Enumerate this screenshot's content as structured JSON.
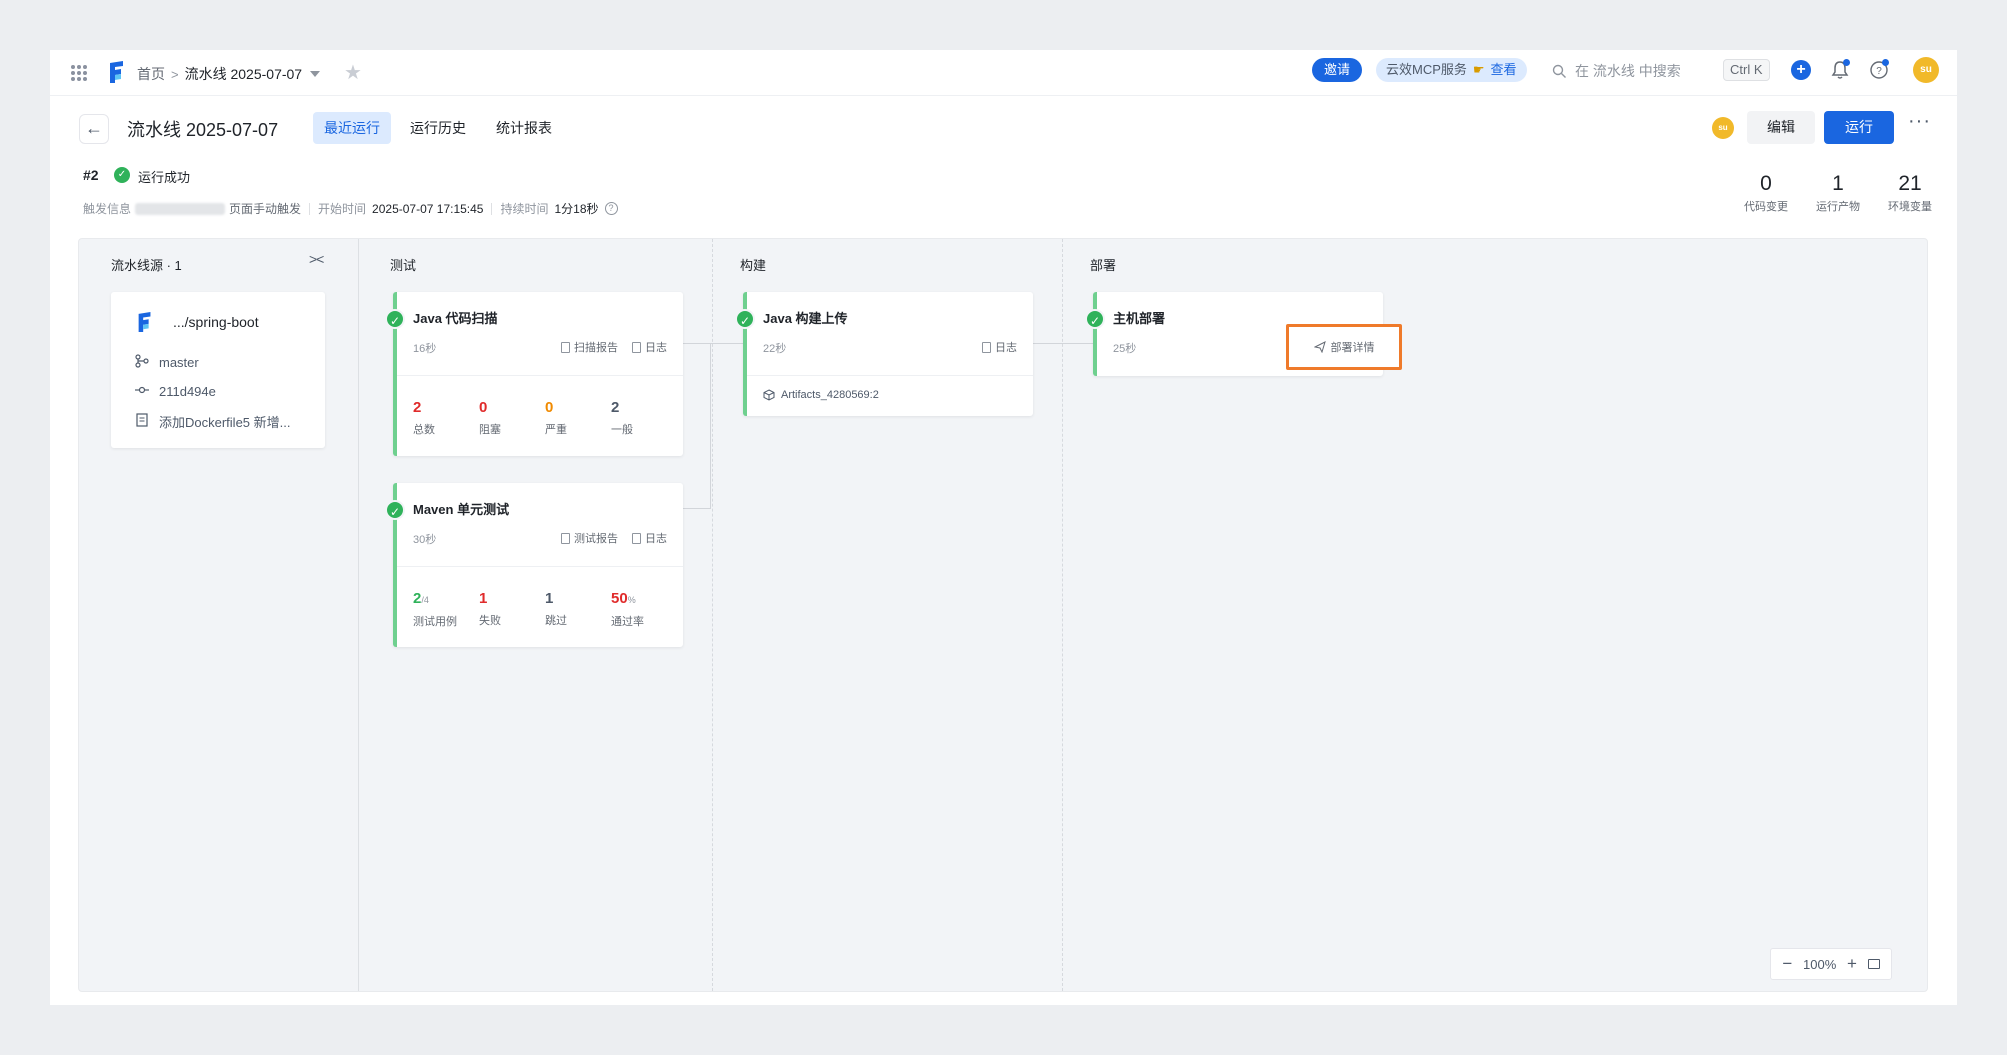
{
  "topbar": {
    "breadcrumb_home": "首页",
    "breadcrumb_current": "流水线 2025-07-07",
    "invite_label": "邀请",
    "mcp_label": "云效MCP服务",
    "mcp_view": "查看",
    "search_placeholder": "在 流水线 中搜索",
    "shortcut": "Ctrl K",
    "avatar": "su"
  },
  "header": {
    "title": "流水线 2025-07-07",
    "tabs": [
      "最近运行",
      "运行历史",
      "统计报表"
    ],
    "active_tab": "最近运行",
    "avatar": "su",
    "edit_label": "编辑",
    "run_label": "运行",
    "more": "···"
  },
  "run": {
    "number": "#2",
    "status": "运行成功",
    "trigger_label": "触发信息",
    "trigger_value": "页面手动触发",
    "start_label": "开始时间",
    "start_value": "2025-07-07 17:15:45",
    "duration_label": "持续时间",
    "duration_value": "1分18秒"
  },
  "stats": [
    {
      "value": "0",
      "label": "代码变更"
    },
    {
      "value": "1",
      "label": "运行产物"
    },
    {
      "value": "21",
      "label": "环境变量"
    }
  ],
  "source": {
    "title": "流水线源 · 1",
    "repo": ".../spring-boot",
    "branch": "master",
    "commit": "211d494e",
    "message": "添加Dockerfile5 新增..."
  },
  "stages": {
    "test": "测试",
    "build": "构建",
    "deploy": "部署"
  },
  "jobs": {
    "scan": {
      "name": "Java 代码扫描",
      "duration": "16秒",
      "report": "扫描报告",
      "log": "日志",
      "metrics": [
        {
          "value": "2",
          "label": "总数"
        },
        {
          "value": "0",
          "label": "阻塞"
        },
        {
          "value": "0",
          "label": "严重"
        },
        {
          "value": "2",
          "label": "一般"
        }
      ]
    },
    "unit": {
      "name": "Maven 单元测试",
      "duration": "30秒",
      "report": "测试报告",
      "log": "日志",
      "cases_value": "2",
      "cases_total": "/4",
      "cases_label": "测试用例",
      "fail_value": "1",
      "fail_label": "失败",
      "skip_value": "1",
      "skip_label": "跳过",
      "rate_value": "50",
      "rate_unit": "%",
      "rate_label": "通过率"
    },
    "build": {
      "name": "Java 构建上传",
      "duration": "22秒",
      "log": "日志",
      "artifact": "Artifacts_4280569:2"
    },
    "deploy": {
      "name": "主机部署",
      "duration": "25秒",
      "detail": "部署详情"
    }
  },
  "zoom": {
    "level": "100%"
  },
  "colors": {
    "primary": "#1a66e0",
    "success": "#2fb25a",
    "danger": "#e02b2b",
    "warning": "#f08a00",
    "highlight": "#ef7a2a"
  }
}
